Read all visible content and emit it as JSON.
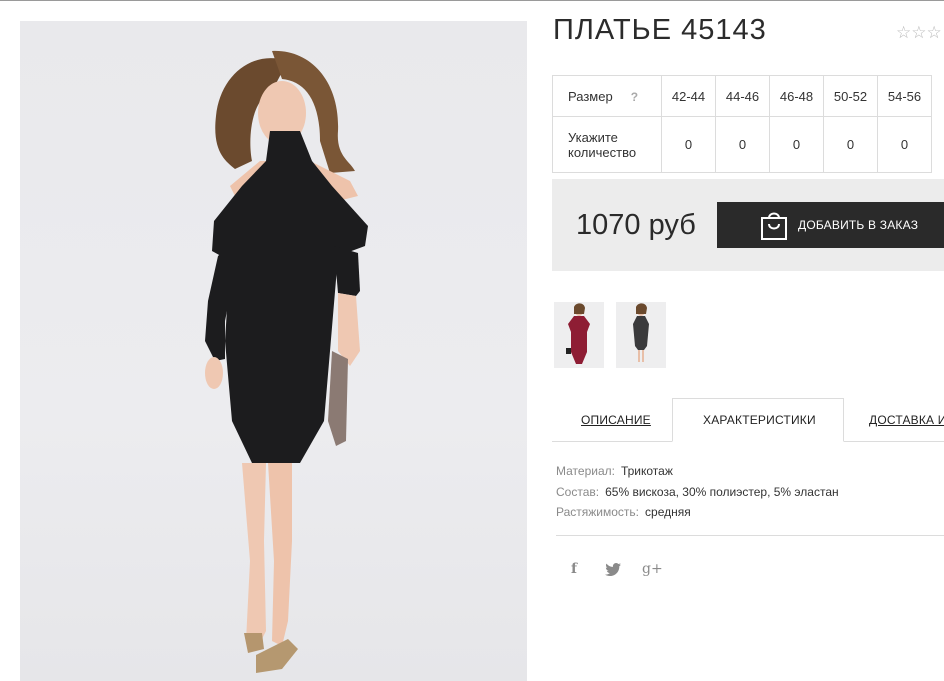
{
  "product": {
    "title": "ПЛАТЬЕ 45143",
    "rating_stars": "☆☆☆"
  },
  "sizes": {
    "header_label": "Размер",
    "help_mark": "?",
    "columns": [
      "42-44",
      "44-46",
      "46-48",
      "50-52",
      "54-56"
    ],
    "qty_label": "Укажите количество",
    "quantities": [
      "0",
      "0",
      "0",
      "0",
      "0"
    ]
  },
  "price": {
    "text": "1070 руб",
    "order_button": "ДОБАВИТЬ В ЗАКАЗ"
  },
  "thumbnails": [
    {
      "color": "#8e1d34"
    },
    {
      "color": "#3a3a3c"
    }
  ],
  "tabs": {
    "description": "ОПИСАНИЕ",
    "characteristics": "ХАРАКТЕРИСТИКИ",
    "delivery": "ДОСТАВКА И"
  },
  "characteristics": [
    {
      "key": "Материал:",
      "value": "Трикотаж"
    },
    {
      "key": "Состав:",
      "value": "65% вискоза, 30% полиэстер, 5% эластан"
    },
    {
      "key": "Растяжимость:",
      "value": "средняя"
    }
  ],
  "social": {
    "facebook": "f",
    "twitter": "twitter-icon",
    "googleplus": "g+"
  },
  "colors": {
    "button_bg": "#2a2a2a",
    "price_box_bg": "#ececec",
    "border": "#dcdcdc"
  }
}
